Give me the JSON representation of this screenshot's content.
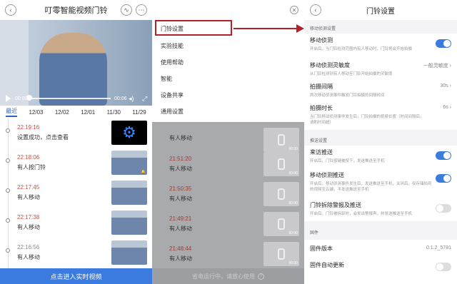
{
  "panel1": {
    "title": "叮零智能视频门铃",
    "video": {
      "time_start": "00:00",
      "time_end": "00:06"
    },
    "dates": [
      "最近",
      "12/03",
      "12/02",
      "12/01",
      "11/30",
      "11/29"
    ],
    "events": [
      {
        "time": "22:19:16",
        "desc": "设置成功，点击查看",
        "time_color": "red",
        "thumb": "gear"
      },
      {
        "time": "22:18:06",
        "desc": "有人按门铃",
        "time_color": "red",
        "thumb": "photo"
      },
      {
        "time": "22:17:45",
        "desc": "有人移动",
        "time_color": "red",
        "thumb": "photo"
      },
      {
        "time": "22:17:38",
        "desc": "有人移动",
        "time_color": "red",
        "thumb": "photo"
      },
      {
        "time": "22:16:56",
        "desc": "有人移动",
        "time_color": "grey",
        "thumb": "photo"
      }
    ],
    "live_button": "点击进入实时视频"
  },
  "panel2": {
    "menu_items": [
      "门铃设置",
      "实验技能",
      "使用帮助",
      "智能",
      "设备共享",
      "通用设置"
    ],
    "dim_events": [
      {
        "time": "",
        "desc": "有人移动",
        "tag": "00:00"
      },
      {
        "time": "21:51:20",
        "desc": "有人移动",
        "tag": "00:00"
      },
      {
        "time": "21:50:35",
        "desc": "有人移动",
        "tag": "00:00"
      },
      {
        "time": "21:49:21",
        "desc": "有人移动",
        "tag": "00:00"
      },
      {
        "time": "21:48:44",
        "desc": "有人移动",
        "tag": "00:00"
      }
    ],
    "footer": "省电运行中，请放心使用"
  },
  "panel3": {
    "title": "门铃设置",
    "section_motion": "移动侦测设置",
    "motion": {
      "title": "移动侦测",
      "desc": "开启后，当门铃检测范围内有人移动时，门铃将会开始拍摄",
      "on": true
    },
    "sensitivity": {
      "title": "移动侦测灵敏度",
      "desc": "从门铃检测到有人移动至门铃开始拍摄的灵敏度",
      "value": "一般灵敏度"
    },
    "interval": {
      "title": "拍摄间隔",
      "desc": "两次移动侦测事件触发门铃拍摄的间隔时间",
      "value": "30s"
    },
    "duration": {
      "title": "拍摄时长",
      "desc": "当门铃移动侦测事件发生后，门铃拍摄的视频长度（时间间隔后，请酌时间超）",
      "value": "6s"
    },
    "section_push": "推送设置",
    "bell_push": {
      "title": "来访推送",
      "desc": "开启后，门铃按键被按下，发送推送至手机",
      "on": true
    },
    "motion_push": {
      "title": "移动侦测推送",
      "desc": "开启后，移动侦测事件发生后，发送推送至手机，关闭后，仅存储拍到的视频至云端，不发送推送至手机",
      "on": true
    },
    "tamper_push": {
      "title": "门铃拆除警报及推送",
      "desc": "开启后，门铃被拆卸时，会发出警报声，并发送推送至手机",
      "on": false
    },
    "section_firmware": "固件",
    "firmware": {
      "title": "固件版本",
      "value": "0.1.2_5781"
    },
    "auto_update": {
      "title": "固件自动更新",
      "on": false
    }
  },
  "annotation_color": "#b3212b"
}
